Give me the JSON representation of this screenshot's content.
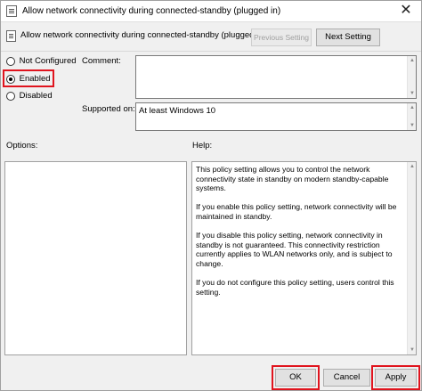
{
  "window": {
    "title": "Allow network connectivity during connected-standby (plugged in)",
    "close_glyph": "✕"
  },
  "header": {
    "policy_name": "Allow network connectivity during connected-standby (plugged in)",
    "previous_label": "Previous Setting",
    "next_label": "Next Setting"
  },
  "state": {
    "options": [
      {
        "label": "Not Configured",
        "checked": false
      },
      {
        "label": "Enabled",
        "checked": true
      },
      {
        "label": "Disabled",
        "checked": false
      }
    ],
    "highlight_color": "#e0141e"
  },
  "comment": {
    "label": "Comment:",
    "value": ""
  },
  "supported": {
    "label": "Supported on:",
    "value": "At least Windows 10"
  },
  "options_panel": {
    "label": "Options:"
  },
  "help": {
    "label": "Help:",
    "paragraphs": [
      "This policy setting allows you to control the network connectivity state in standby on modern standby-capable systems.",
      "If you enable this policy setting, network connectivity will be maintained in standby.",
      "If you disable this policy setting, network connectivity in standby is not guaranteed. This connectivity restriction currently applies to WLAN networks only, and is subject to change.",
      "If you do not configure this policy setting, users control this setting."
    ]
  },
  "footer": {
    "ok_label": "OK",
    "cancel_label": "Cancel",
    "apply_label": "Apply"
  }
}
